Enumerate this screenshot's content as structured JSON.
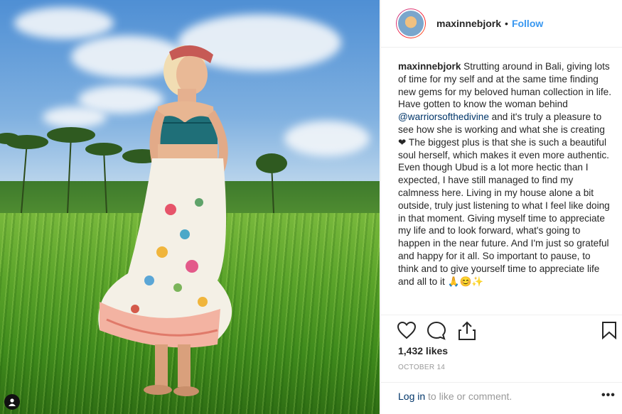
{
  "post": {
    "username": "maxinnebjork",
    "separator": "•",
    "follow_label": "Follow",
    "caption_user": "maxinnebjork",
    "caption_part1": "Strutting around in Bali, giving lots of time for my self and at the same time finding new gems for my beloved human collection in life. Have gotten to know the woman behind ",
    "mention": "@warriorsofthedivine",
    "caption_part2": " and it's truly a pleasure to see how she is working and what she is creating ❤ The biggest plus is that she is such a beautiful soul herself, which makes it even more authentic. Even though Ubud is a lot more hectic than I expected, I have still managed to find my calmness here. Living in my house alone a bit outside, truly just listening to what I feel like doing in that moment. Giving myself time to appreciate my life and to look forward, what's going to happen in the near future. And I'm just so grateful and happy for it all. So important to pause, to think and to give yourself time to appreciate life and all to it 🙏😊✨",
    "likes": "1,432 likes",
    "date": "OCTOBER 14",
    "login_link": "Log in",
    "login_rest": " to like or comment.",
    "more_label": "•••"
  },
  "icons": {
    "like": "heart-icon",
    "comment": "comment-icon",
    "share": "share-icon",
    "save": "bookmark-icon",
    "tag": "user-tag-icon"
  }
}
